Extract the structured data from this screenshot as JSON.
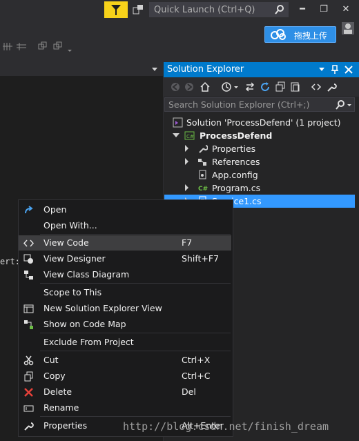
{
  "titlebar": {
    "quick_launch_placeholder": "Quick Launch (Ctrl+Q)",
    "minimize": "━",
    "restore": "❐",
    "close": "✕"
  },
  "toolbar": {
    "upload_label": "拖拽上传"
  },
  "editor": {
    "fragment": "ert:"
  },
  "solution_explorer": {
    "title": "Solution Explorer",
    "search_placeholder": "Search Solution Explorer (Ctrl+;)",
    "tree": [
      {
        "label": "Solution 'ProcessDefend' (1 project)",
        "icon": "solution-icon"
      },
      {
        "label": "ProcessDefend",
        "icon": "csharp-project-icon"
      },
      {
        "label": "Properties",
        "icon": "wrench-icon"
      },
      {
        "label": "References",
        "icon": "references-icon"
      },
      {
        "label": "App.config",
        "icon": "config-file-icon"
      },
      {
        "label": "Program.cs",
        "icon": "csharp-file-icon"
      },
      {
        "label": "Service1.cs",
        "icon": "service-file-icon"
      }
    ]
  },
  "context_menu": {
    "items": [
      {
        "label": "Open",
        "shortcut": ""
      },
      {
        "label": "Open With...",
        "shortcut": ""
      },
      {
        "label": "View Code",
        "shortcut": "F7"
      },
      {
        "label": "View Designer",
        "shortcut": "Shift+F7"
      },
      {
        "label": "View Class Diagram",
        "shortcut": ""
      },
      {
        "label": "Scope to This",
        "shortcut": ""
      },
      {
        "label": "New Solution Explorer View",
        "shortcut": ""
      },
      {
        "label": "Show on Code Map",
        "shortcut": ""
      },
      {
        "label": "Exclude From Project",
        "shortcut": ""
      },
      {
        "label": "Cut",
        "shortcut": "Ctrl+X"
      },
      {
        "label": "Copy",
        "shortcut": "Ctrl+C"
      },
      {
        "label": "Delete",
        "shortcut": "Del"
      },
      {
        "label": "Rename",
        "shortcut": ""
      },
      {
        "label": "Properties",
        "shortcut": "Alt+Enter"
      }
    ]
  },
  "watermark": "http://blog.csdn.net/finish_dream",
  "colors": {
    "accent": "#007acc",
    "selection": "#3399ff",
    "menu_bg": "#1b1b1c",
    "highlight": "#3e3e40"
  }
}
